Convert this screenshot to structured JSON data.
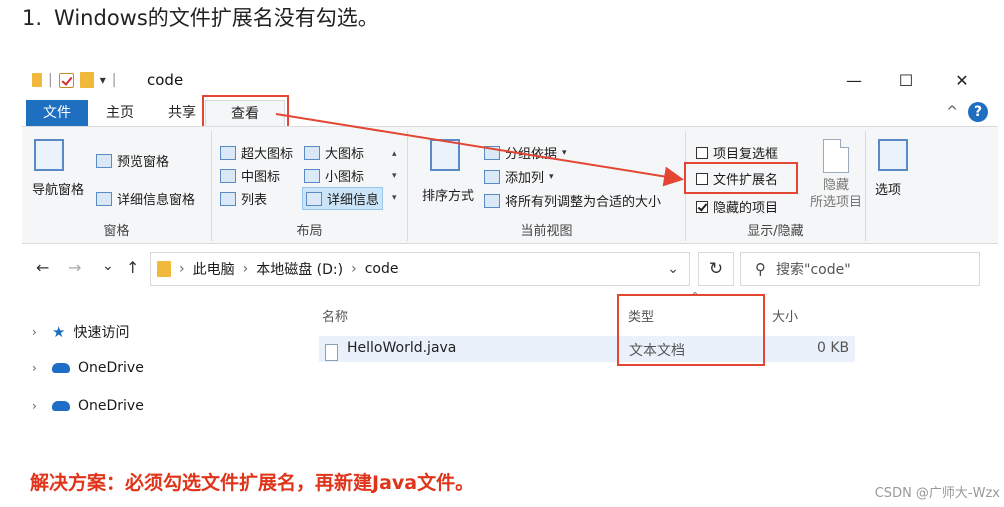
{
  "heading": {
    "number": "1.",
    "text": "Windows的文件扩展名没有勾选。"
  },
  "window": {
    "title": "code",
    "qat_separator": "|",
    "qat_caret": "▾",
    "controls": {
      "minimize": "—",
      "maximize": "☐",
      "close": "✕"
    }
  },
  "ribbon_tabs": {
    "file": "文件",
    "home": "主页",
    "share": "共享",
    "view": "查看",
    "collapse": "^",
    "help": "?"
  },
  "ribbon": {
    "panes": {
      "nav_pane": "导航窗格",
      "preview_pane": "预览窗格",
      "details_pane": "详细信息窗格",
      "label": "窗格"
    },
    "layout": {
      "extra_large": "超大图标",
      "large": "大图标",
      "medium": "中图标",
      "small": "小图标",
      "list": "列表",
      "details": "详细信息",
      "label": "布局"
    },
    "current_view": {
      "sort_by": "排序方式",
      "group_by": "分组依据",
      "add_column": "添加列",
      "fit_columns": "将所有列调整为合适的大小",
      "label": "当前视图"
    },
    "show_hide": {
      "item_checkboxes": "项目复选框",
      "file_extensions": "文件扩展名",
      "hidden_items": "隐藏的项目",
      "hide_selected_line1": "隐藏",
      "hide_selected_line2": "所选项目",
      "options": "选项",
      "label": "显示/隐藏",
      "states": {
        "item_checkboxes": false,
        "file_extensions": false,
        "hidden_items": true
      }
    }
  },
  "address": {
    "back": "←",
    "forward": "→",
    "recent": "⌄",
    "up": "↑",
    "crumbs": [
      "此电脑",
      "本地磁盘 (D:)",
      "code"
    ],
    "crumb_sep": "›",
    "dropdown": "⌄",
    "refresh": "↻",
    "search_placeholder": "搜索\"code\""
  },
  "nav_pane": {
    "items": [
      "快速访问",
      "OneDrive",
      "OneDrive"
    ],
    "chevron": "›"
  },
  "columns": {
    "name": "名称",
    "type": "类型",
    "size": "大小",
    "sort_indicator": "^"
  },
  "files": [
    {
      "name": "HelloWorld.java",
      "type": "文本文档",
      "size": "0 KB"
    }
  ],
  "solution": "解决方案：必须勾选文件扩展名，再新建Java文件。",
  "watermark": "CSDN @广师大-Wzx",
  "colors": {
    "accent": "#1e6fc0",
    "highlight_red": "#e44634",
    "solution_red": "#e0341a"
  }
}
